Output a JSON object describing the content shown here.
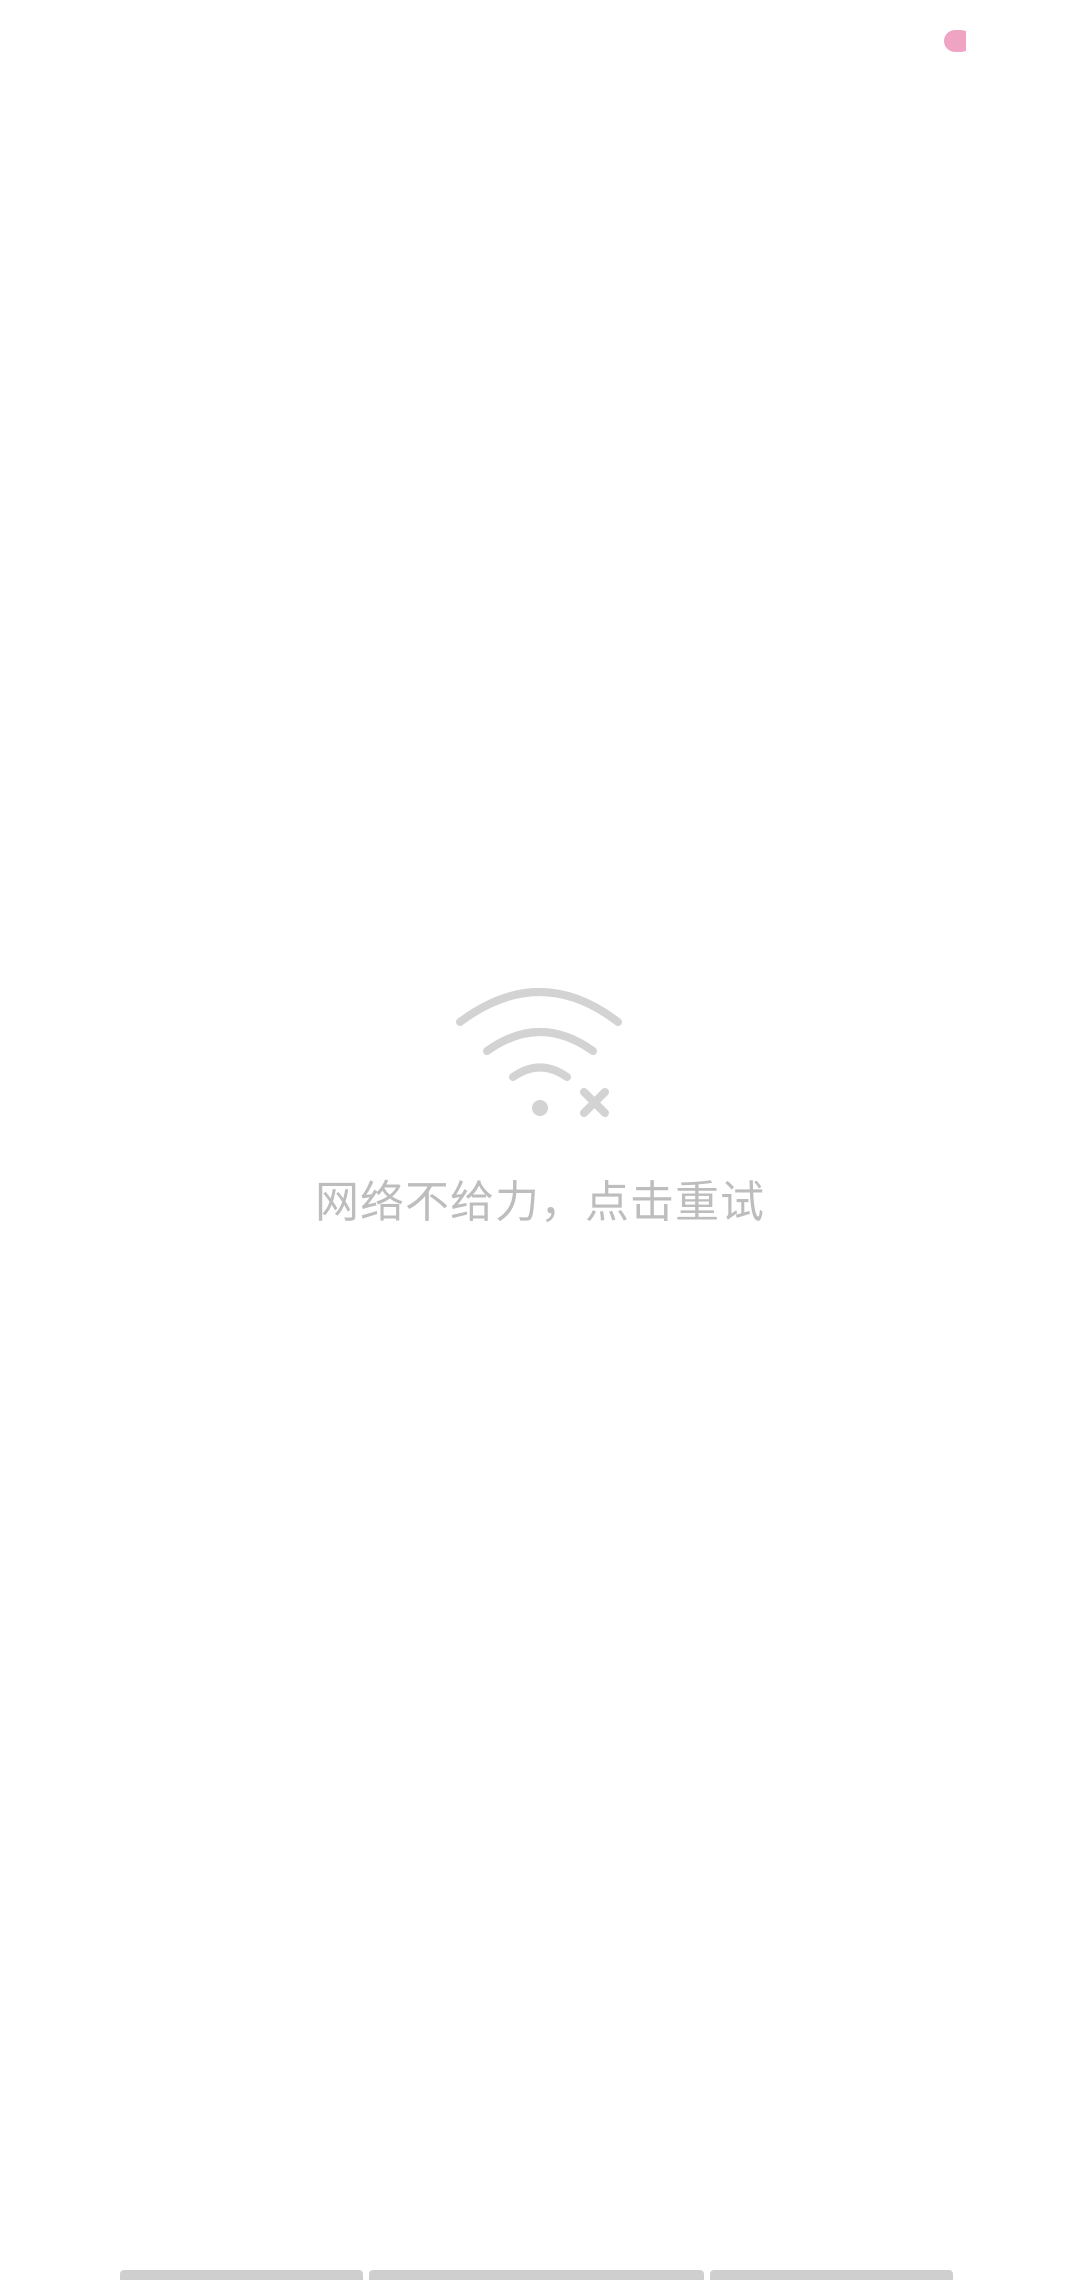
{
  "error": {
    "message": "网络不给力，点击重试",
    "icon": "wifi-off-icon"
  },
  "colors": {
    "icon_gray": "#d3d3d3",
    "text_gray": "#bdbdbd",
    "status_dot": "#f0a4c4",
    "bar_gray": "#cfcfcf"
  }
}
